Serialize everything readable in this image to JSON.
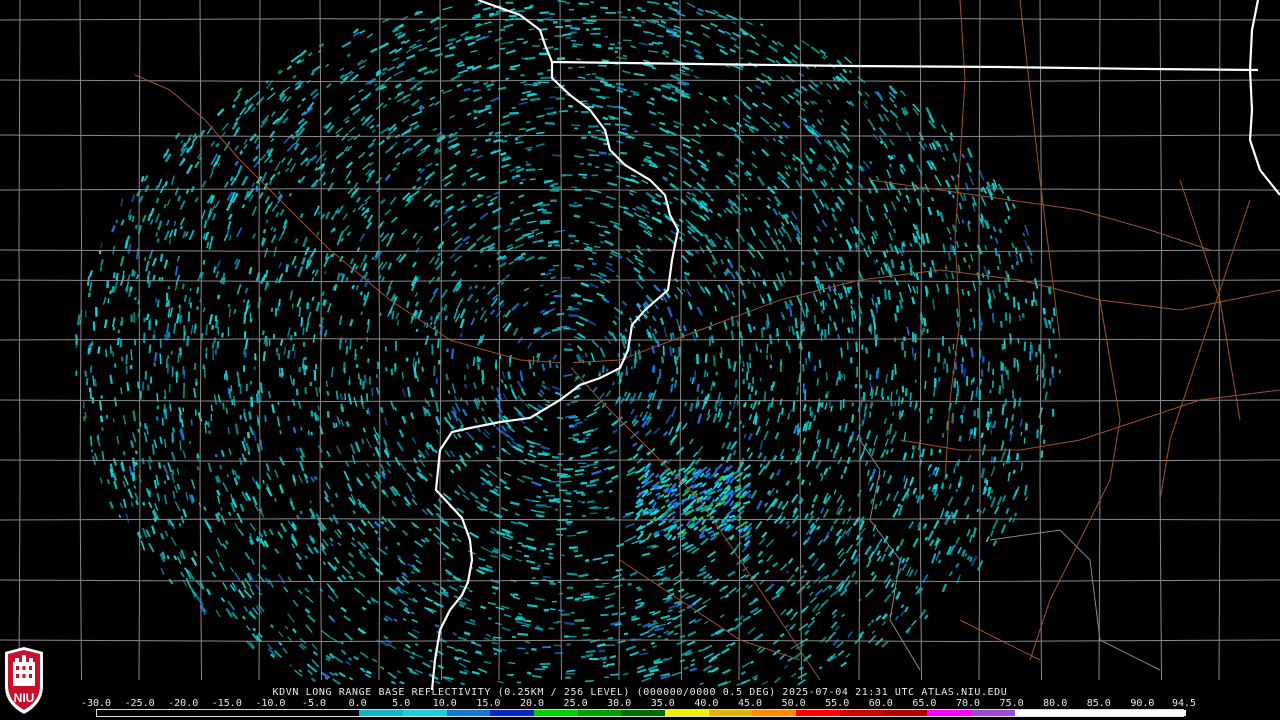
{
  "product": {
    "caption": "KDVN LONG RANGE BASE REFLECTIVITY (0.25KM / 256 LEVEL) (000000/0000 0.5 DEG) 2025-07-04 21:31 UTC   ATLAS.NIU.EDU"
  },
  "logo": {
    "text": "NIU"
  },
  "colorbar": {
    "labels": [
      "-30.0",
      "-25.0",
      "-20.0",
      "-15.0",
      "-10.0",
      "-5.0",
      "0.0",
      "5.0",
      "10.0",
      "15.0",
      "20.0",
      "25.0",
      "30.0",
      "35.0",
      "40.0",
      "45.0",
      "50.0",
      "55.0",
      "60.0",
      "65.0",
      "70.0",
      "75.0",
      "80.0",
      "85.0",
      "90.0",
      "94.5"
    ],
    "min": -30.0,
    "max": 94.5,
    "stops": [
      {
        "from": -30,
        "to": 0,
        "color": "#000000"
      },
      {
        "from": 0,
        "to": 5,
        "color": "#14b4c8"
      },
      {
        "from": 5,
        "to": 10,
        "color": "#1ecbe0"
      },
      {
        "from": 10,
        "to": 15,
        "color": "#1478d2"
      },
      {
        "from": 15,
        "to": 20,
        "color": "#0a28c8"
      },
      {
        "from": 20,
        "to": 25,
        "color": "#00d200"
      },
      {
        "from": 25,
        "to": 30,
        "color": "#00a000"
      },
      {
        "from": 30,
        "to": 35,
        "color": "#006e00"
      },
      {
        "from": 35,
        "to": 40,
        "color": "#f0f000"
      },
      {
        "from": 40,
        "to": 45,
        "color": "#e6b400"
      },
      {
        "from": 45,
        "to": 50,
        "color": "#ff8c00"
      },
      {
        "from": 50,
        "to": 55,
        "color": "#ff0000"
      },
      {
        "from": 55,
        "to": 60,
        "color": "#d20000"
      },
      {
        "from": 60,
        "to": 65,
        "color": "#b40000"
      },
      {
        "from": 65,
        "to": 70,
        "color": "#ff00ff"
      },
      {
        "from": 70,
        "to": 75,
        "color": "#9a4cd6"
      },
      {
        "from": 75,
        "to": 94.5,
        "color": "#ffffff"
      }
    ]
  },
  "colors": {
    "background": "#000000",
    "county_lines": "#8a8a8a",
    "state_lines": "#ffffff",
    "highways": "#a0522d",
    "echo_main": "#17d7d7",
    "echo_blue": "#1e78e6",
    "echo_green": "#22c83c"
  }
}
